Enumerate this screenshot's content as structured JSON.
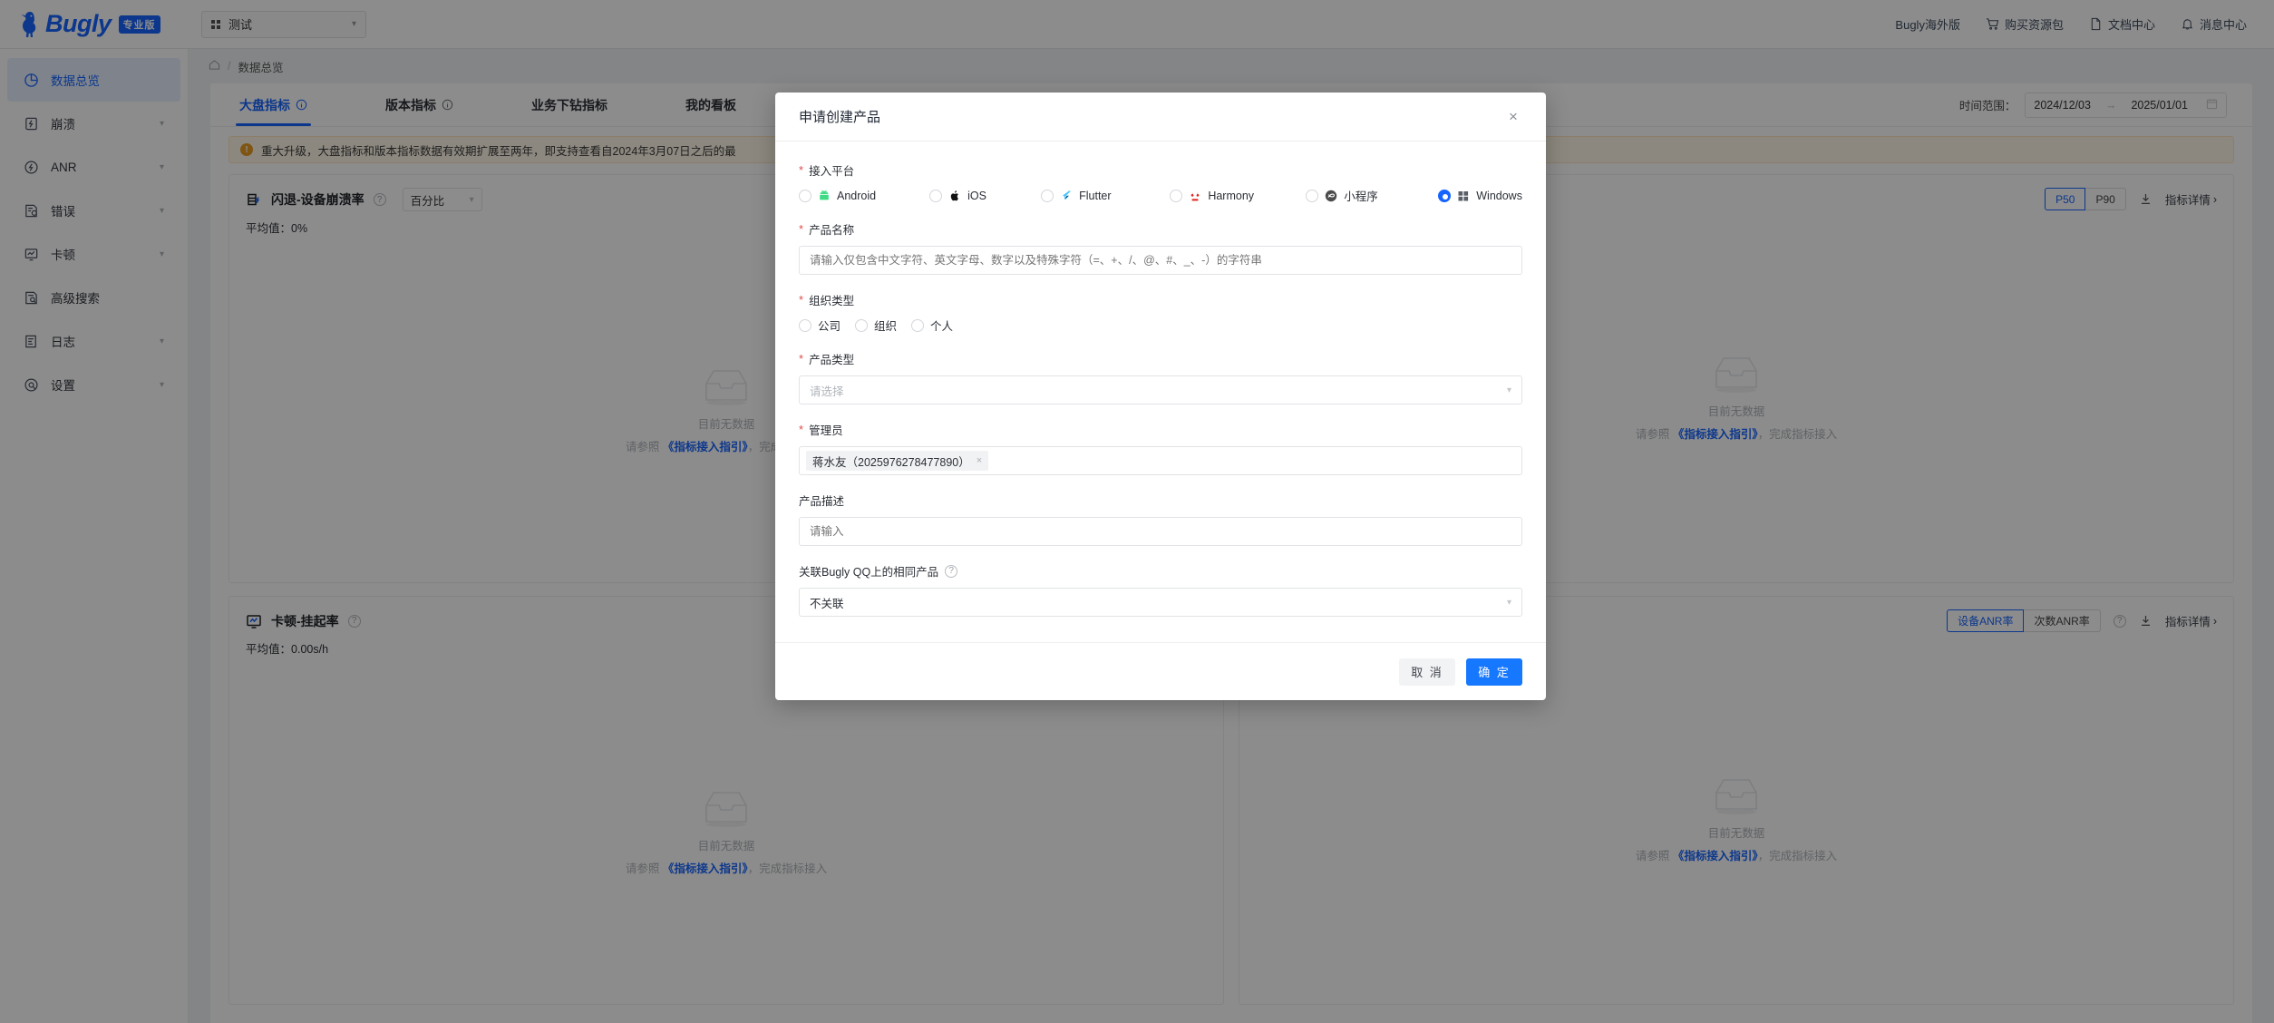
{
  "header": {
    "brand": "Bugly",
    "brand_badge": "专业版",
    "project_name": "测试",
    "links": [
      {
        "label": "Bugly海外版",
        "icon": ""
      },
      {
        "label": "购买资源包",
        "icon": "cart-icon"
      },
      {
        "label": "文档中心",
        "icon": "document-icon"
      },
      {
        "label": "消息中心",
        "icon": "bell-icon"
      }
    ]
  },
  "sidebar": {
    "items": [
      {
        "label": "数据总览",
        "icon": "pie-chart-icon",
        "active": true,
        "expandable": false
      },
      {
        "label": "崩溃",
        "icon": "crash-icon",
        "active": false,
        "expandable": true
      },
      {
        "label": "ANR",
        "icon": "anr-icon",
        "active": false,
        "expandable": true
      },
      {
        "label": "错误",
        "icon": "error-icon",
        "active": false,
        "expandable": true
      },
      {
        "label": "卡顿",
        "icon": "lag-icon",
        "active": false,
        "expandable": true
      },
      {
        "label": "高级搜索",
        "icon": "advanced-search-icon",
        "active": false,
        "expandable": false
      },
      {
        "label": "日志",
        "icon": "log-icon",
        "active": false,
        "expandable": true
      },
      {
        "label": "设置",
        "icon": "settings-icon",
        "active": false,
        "expandable": true
      }
    ]
  },
  "breadcrumb": {
    "home": "⌂",
    "sep": "/",
    "current": "数据总览"
  },
  "tabs": [
    {
      "label": "大盘指标",
      "info": true,
      "active": true
    },
    {
      "label": "版本指标",
      "info": true,
      "active": false
    },
    {
      "label": "业务下钻指标",
      "info": false,
      "active": false
    },
    {
      "label": "我的看板",
      "info": false,
      "active": false
    }
  ],
  "daterange": {
    "label": "时间范围：",
    "start": "2024/12/03",
    "arrow": "→",
    "end": "2025/01/01"
  },
  "banner": {
    "text": "重大升级，大盘指标和版本指标数据有效期扩展至两年，即支持查看自2024年3月07日之后的最"
  },
  "cards": [
    {
      "title": "闪退-设备崩溃率",
      "icon": "database-crash-icon",
      "unit_select": "百分比",
      "avg_label": "平均值：",
      "avg_value": "0%",
      "segments": [
        {
          "label": "P50",
          "on": true
        },
        {
          "label": "P90",
          "on": false
        }
      ],
      "has_question": false,
      "download": "download-icon",
      "detail": "指标详情",
      "empty_title": "目前无数据",
      "empty_prefix": "请参照",
      "empty_link": "《指标接入指引》",
      "empty_suffix": "，完成指标接入"
    },
    {
      "title": "",
      "icon": "",
      "unit_select": "",
      "avg_label": "",
      "avg_value": "",
      "segments": [
        {
          "label": "P50",
          "on": true
        },
        {
          "label": "P90",
          "on": false
        }
      ],
      "has_question": false,
      "download": "download-icon",
      "detail": "指标详情",
      "empty_title": "目前无数据",
      "empty_prefix": "请参照",
      "empty_link": "《指标接入指引》",
      "empty_suffix": "，完成指标接入"
    },
    {
      "title": "卡顿-挂起率",
      "icon": "lag-monitor-icon",
      "unit_select": "",
      "avg_label": "平均值：",
      "avg_value": "0.00s/h",
      "segments": [
        {
          "label": "设备ANR率",
          "on": true
        },
        {
          "label": "次数ANR率",
          "on": false
        }
      ],
      "has_question": true,
      "download": "download-icon",
      "detail": "指标详情",
      "empty_title": "目前无数据",
      "empty_prefix": "请参照",
      "empty_link": "《指标接入指引》",
      "empty_suffix": "，完成指标接入"
    },
    {
      "title": "",
      "icon": "",
      "unit_select": "",
      "avg_label": "",
      "avg_value": "",
      "segments": [
        {
          "label": "设备ANR率",
          "on": true
        },
        {
          "label": "次数ANR率",
          "on": false
        }
      ],
      "has_question": true,
      "download": "download-icon",
      "detail": "指标详情",
      "empty_title": "目前无数据",
      "empty_prefix": "请参照",
      "empty_link": "《指标接入指引》",
      "empty_suffix": "，完成指标接入"
    }
  ],
  "modal": {
    "title": "申请创建产品",
    "close": "×",
    "platform": {
      "label": "接入平台",
      "options": [
        {
          "label": "Android",
          "icon": "android-icon",
          "selected": false
        },
        {
          "label": "iOS",
          "icon": "apple-icon",
          "selected": false
        },
        {
          "label": "Flutter",
          "icon": "flutter-icon",
          "selected": false
        },
        {
          "label": "Harmony",
          "icon": "harmony-icon",
          "selected": false
        },
        {
          "label": "小程序",
          "icon": "miniprogram-icon",
          "selected": false
        },
        {
          "label": "Windows",
          "icon": "windows-icon",
          "selected": true
        }
      ]
    },
    "product_name": {
      "label": "产品名称",
      "value": "",
      "placeholder": "请输入仅包含中文字符、英文字母、数字以及特殊字符（=、+、/、@、#、_、-）的字符串"
    },
    "org_type": {
      "label": "组织类型",
      "options": [
        {
          "label": "公司",
          "selected": false
        },
        {
          "label": "组织",
          "selected": false
        },
        {
          "label": "个人",
          "selected": false
        }
      ]
    },
    "product_type": {
      "label": "产品类型",
      "value": "",
      "placeholder": "请选择"
    },
    "admin": {
      "label": "管理员",
      "tags": [
        {
          "name": "蒋水友（2025976278477890）",
          "remove": "×"
        }
      ]
    },
    "description": {
      "label": "产品描述",
      "value": "",
      "placeholder": "请输入"
    },
    "qq_link": {
      "label": "关联Bugly QQ上的相同产品",
      "help": "?",
      "value": "不关联"
    },
    "footer": {
      "cancel": "取 消",
      "confirm": "确 定"
    }
  },
  "colors": {
    "brand": "#1664ff",
    "primary_button": "#1677ff",
    "warning": "#e89b25",
    "required": "#e34d4d"
  }
}
